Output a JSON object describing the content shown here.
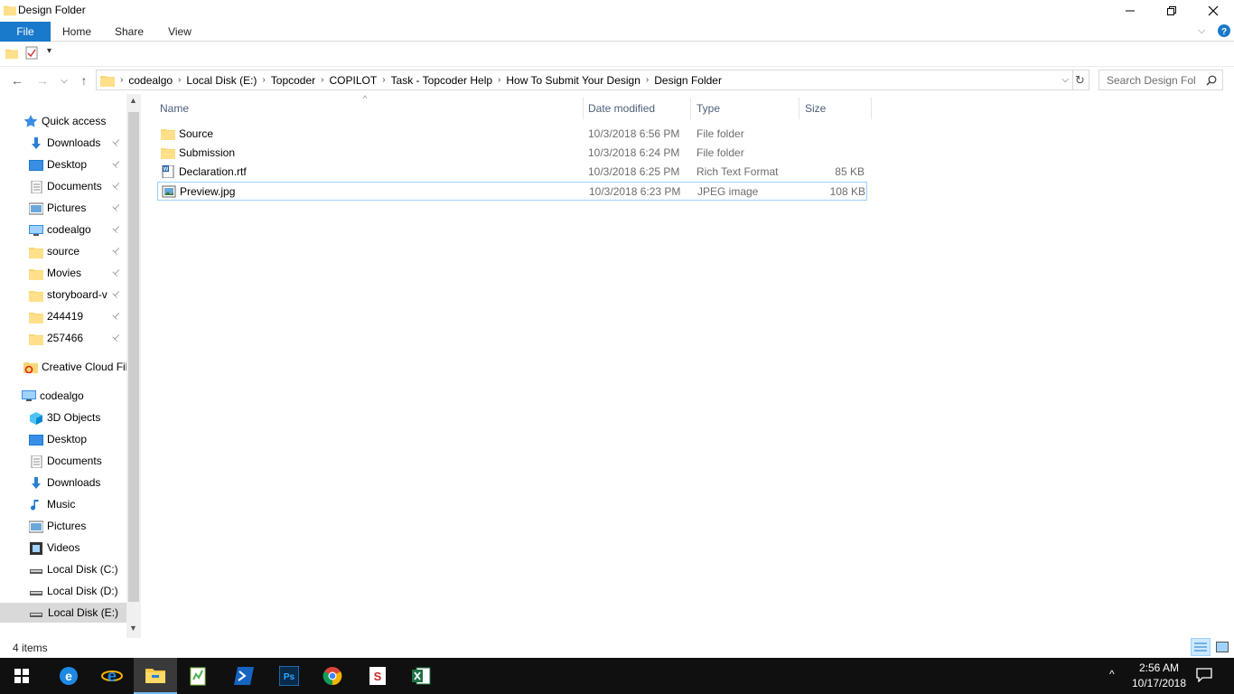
{
  "window": {
    "title": "Design Folder"
  },
  "ribbon": {
    "tabs": [
      "File",
      "Home",
      "Share",
      "View"
    ]
  },
  "address": {
    "crumbs": [
      "codealgo",
      "Local Disk (E:)",
      "Topcoder",
      "COPILOT",
      "Task - Topcoder Help",
      "How To Submit Your Design",
      "Design Folder"
    ]
  },
  "search": {
    "placeholder": "Search Design Fol"
  },
  "nav": {
    "quick_access_label": "Quick access",
    "quick_items": [
      {
        "label": "Downloads",
        "icon": "download-arrow-icon"
      },
      {
        "label": "Desktop",
        "icon": "desktop-icon"
      },
      {
        "label": "Documents",
        "icon": "documents-icon"
      },
      {
        "label": "Pictures",
        "icon": "pictures-icon"
      },
      {
        "label": "codealgo",
        "icon": "computer-icon"
      },
      {
        "label": "source",
        "icon": "folder-icon"
      },
      {
        "label": "Movies",
        "icon": "folder-icon"
      },
      {
        "label": "storyboard-v",
        "icon": "folder-icon"
      },
      {
        "label": "244419",
        "icon": "folder-icon"
      },
      {
        "label": "257466",
        "icon": "folder-icon"
      }
    ],
    "creative_cloud": "Creative Cloud Fil",
    "pc_label": "codealgo",
    "pc_items": [
      {
        "label": "3D Objects",
        "icon": "3d-objects-icon"
      },
      {
        "label": "Desktop",
        "icon": "desktop-icon"
      },
      {
        "label": "Documents",
        "icon": "documents-icon"
      },
      {
        "label": "Downloads",
        "icon": "download-arrow-icon"
      },
      {
        "label": "Music",
        "icon": "music-icon"
      },
      {
        "label": "Pictures",
        "icon": "pictures-icon"
      },
      {
        "label": "Videos",
        "icon": "videos-icon"
      },
      {
        "label": "Local Disk (C:)",
        "icon": "drive-icon"
      },
      {
        "label": "Local Disk (D:)",
        "icon": "drive-icon"
      },
      {
        "label": "Local Disk (E:)",
        "icon": "drive-icon"
      }
    ]
  },
  "table": {
    "columns": [
      "Name",
      "Date modified",
      "Type",
      "Size"
    ],
    "rows": [
      {
        "name": "Source",
        "date": "10/3/2018 6:56 PM",
        "type": "File folder",
        "size": "",
        "icon": "folder-icon"
      },
      {
        "name": "Submission",
        "date": "10/3/2018 6:24 PM",
        "type": "File folder",
        "size": "",
        "icon": "folder-icon"
      },
      {
        "name": "Declaration.rtf",
        "date": "10/3/2018 6:25 PM",
        "type": "Rich Text Format",
        "size": "85 KB",
        "icon": "rtf-document-icon"
      },
      {
        "name": "Preview.jpg",
        "date": "10/3/2018 6:23 PM",
        "type": "JPEG image",
        "size": "108 KB",
        "icon": "image-file-icon"
      }
    ]
  },
  "status": {
    "count": "4 items"
  },
  "taskbar": {
    "time": "2:56 AM",
    "date": "10/17/2018",
    "apps": [
      "start-icon",
      "edge-icon",
      "ie-icon",
      "file-explorer-icon",
      "notepad-plus-icon",
      "powershell-icon",
      "photoshop-icon",
      "chrome-icon",
      "sourcetree-icon",
      "excel-icon"
    ]
  },
  "colors": {
    "accent": "#1979ca",
    "selection_border": "#99d1ff",
    "folder_yellow": "#f8d775"
  }
}
